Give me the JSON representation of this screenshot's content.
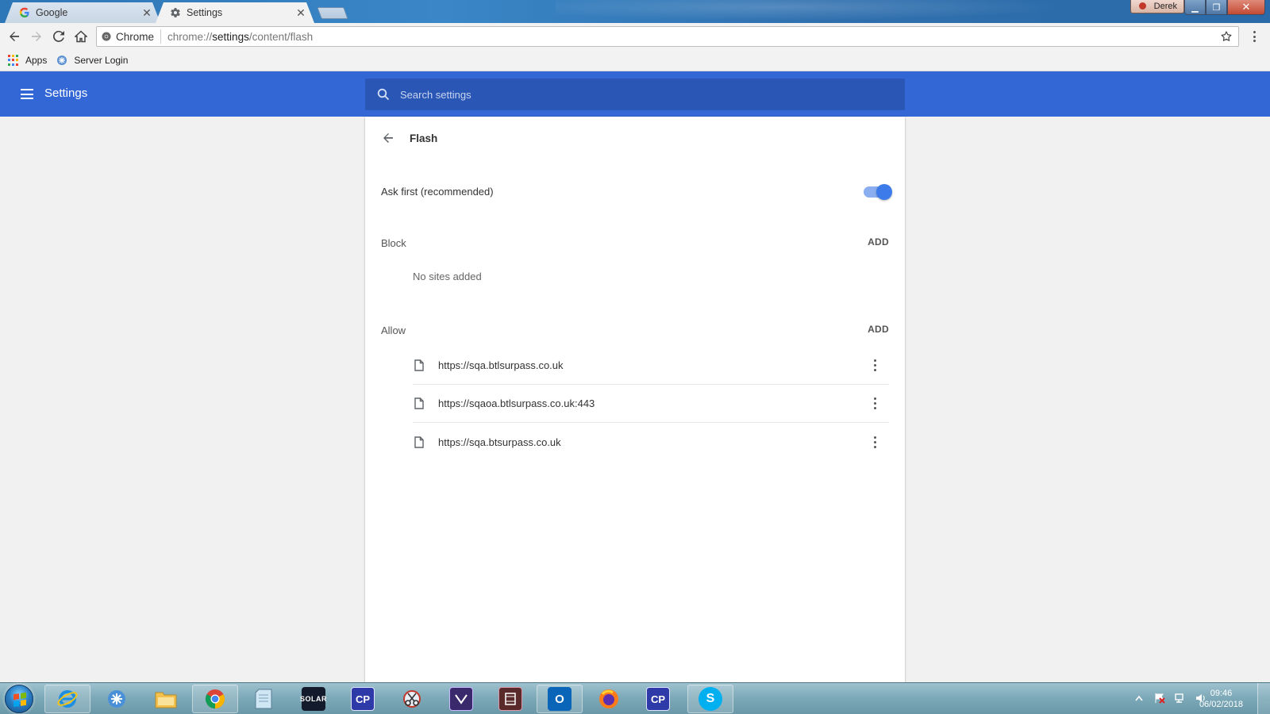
{
  "tabs": [
    {
      "title": "Google",
      "active": false,
      "icon": "google-g-icon"
    },
    {
      "title": "Settings",
      "active": true,
      "icon": "gear-icon"
    }
  ],
  "window": {
    "user": "Derek"
  },
  "toolbar": {
    "site_chip": "Chrome",
    "url_prefix": "chrome://",
    "url_host": "settings",
    "url_path": "/content/flash"
  },
  "bookmarks": [
    {
      "label": "Apps",
      "icon": "apps-grid-icon"
    },
    {
      "label": "Server Login",
      "icon": "server-login-icon"
    }
  ],
  "settings": {
    "title": "Settings",
    "search_placeholder": "Search settings"
  },
  "flash": {
    "title": "Flash",
    "ask_first_label": "Ask first (recommended)",
    "ask_first_enabled": true,
    "block": {
      "label": "Block",
      "add_label": "ADD",
      "empty_text": "No sites added"
    },
    "allow": {
      "label": "Allow",
      "add_label": "ADD",
      "sites": [
        "https://sqa.btlsurpass.co.uk",
        "https://sqaoa.btlsurpass.co.uk:443",
        "https://sqa.btsurpass.co.uk"
      ]
    }
  },
  "taskbar": {
    "items": [
      {
        "name": "internet-explorer",
        "label": ""
      },
      {
        "name": "bookmark-app",
        "label": ""
      },
      {
        "name": "file-explorer",
        "label": ""
      },
      {
        "name": "chrome",
        "label": ""
      },
      {
        "name": "notepad",
        "label": ""
      },
      {
        "name": "solar",
        "label": "SOLAR"
      },
      {
        "name": "cp-app-1",
        "label": "CP"
      },
      {
        "name": "snipping-tool",
        "label": ""
      },
      {
        "name": "visual-studio",
        "label": ""
      },
      {
        "name": "media-app",
        "label": ""
      },
      {
        "name": "outlook",
        "label": ""
      },
      {
        "name": "firefox",
        "label": ""
      },
      {
        "name": "cp-app-2",
        "label": "CP"
      },
      {
        "name": "skype",
        "label": ""
      }
    ],
    "time": "09:46",
    "date": "06/02/2018"
  },
  "colors": {
    "header_blue": "#3367d6",
    "search_blue": "#2a56b5",
    "toggle_on": "#3e7bea",
    "card_bg": "#ffffff",
    "page_bg": "#f1f1f1"
  }
}
